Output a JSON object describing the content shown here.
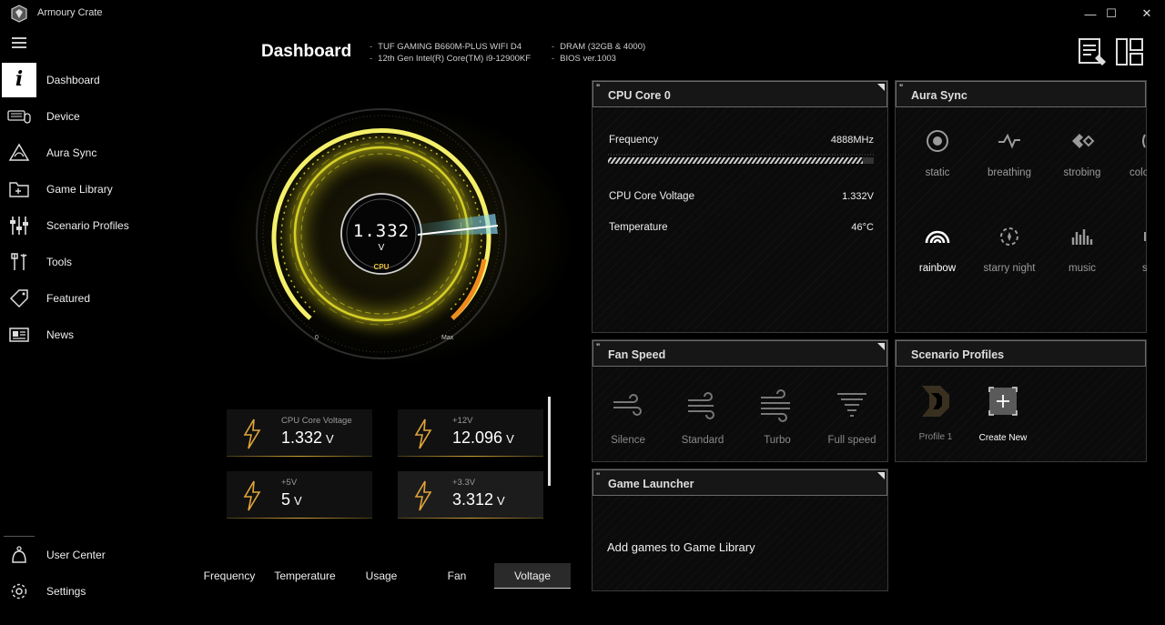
{
  "window": {
    "title": "Armoury Crate",
    "minimize": "—",
    "maximize": "☐",
    "close": "✕"
  },
  "sidebar": {
    "items": [
      {
        "label": "Dashboard",
        "icon": "info-icon"
      },
      {
        "label": "Device",
        "icon": "keyboard-mouse-icon"
      },
      {
        "label": "Aura Sync",
        "icon": "aura-triangle-icon"
      },
      {
        "label": "Game Library",
        "icon": "game-folder-icon"
      },
      {
        "label": "Scenario Profiles",
        "icon": "sliders-icon"
      },
      {
        "label": "Tools",
        "icon": "tools-icon"
      },
      {
        "label": "Featured",
        "icon": "tag-icon"
      },
      {
        "label": "News",
        "icon": "news-icon"
      }
    ],
    "bottom": [
      {
        "label": "User Center",
        "icon": "user-bell-icon"
      },
      {
        "label": "Settings",
        "icon": "gear-icon"
      }
    ]
  },
  "header": {
    "title": "Dashboard",
    "motherboard": "TUF GAMING B660M-PLUS WIFI D4",
    "cpu": "12th Gen Intel(R) Core(TM) i9-12900KF",
    "dram": "DRAM (32GB & 4000)",
    "bios": "BIOS ver.1003"
  },
  "gauge": {
    "value": "1.332",
    "unit": "V",
    "tag": "CPU",
    "min_label": "0",
    "max_label": "Max",
    "accent": "#e8e03a",
    "hot": "#f08a1e"
  },
  "voltages": [
    {
      "label": "CPU Core Voltage",
      "value": "1.332",
      "unit": "V"
    },
    {
      "label": "+12V",
      "value": "12.096",
      "unit": "V"
    },
    {
      "label": "+5V",
      "value": "5",
      "unit": "V"
    },
    {
      "label": "+3.3V",
      "value": "3.312",
      "unit": "V"
    }
  ],
  "tabs": [
    "Frequency",
    "Temperature",
    "Usage",
    "Fan",
    "Voltage"
  ],
  "cpu_panel": {
    "title": "CPU Core 0",
    "frequency_label": "Frequency",
    "frequency_value": "4888MHz",
    "voltage_label": "CPU Core Voltage",
    "voltage_value": "1.332V",
    "temp_label": "Temperature",
    "temp_value": "46°C"
  },
  "aura_panel": {
    "title": "Aura Sync",
    "effects": [
      "static",
      "breathing",
      "strobing",
      "colo",
      "rainbow",
      "starry night",
      "music",
      "s"
    ]
  },
  "fan_panel": {
    "title": "Fan Speed",
    "modes": [
      "Silence",
      "Standard",
      "Turbo",
      "Full speed"
    ]
  },
  "scenario_panel": {
    "title": "Scenario Profiles",
    "profile": "Profile 1",
    "create": "Create New"
  },
  "game_panel": {
    "title": "Game Launcher",
    "message": "Add games to Game Library"
  }
}
